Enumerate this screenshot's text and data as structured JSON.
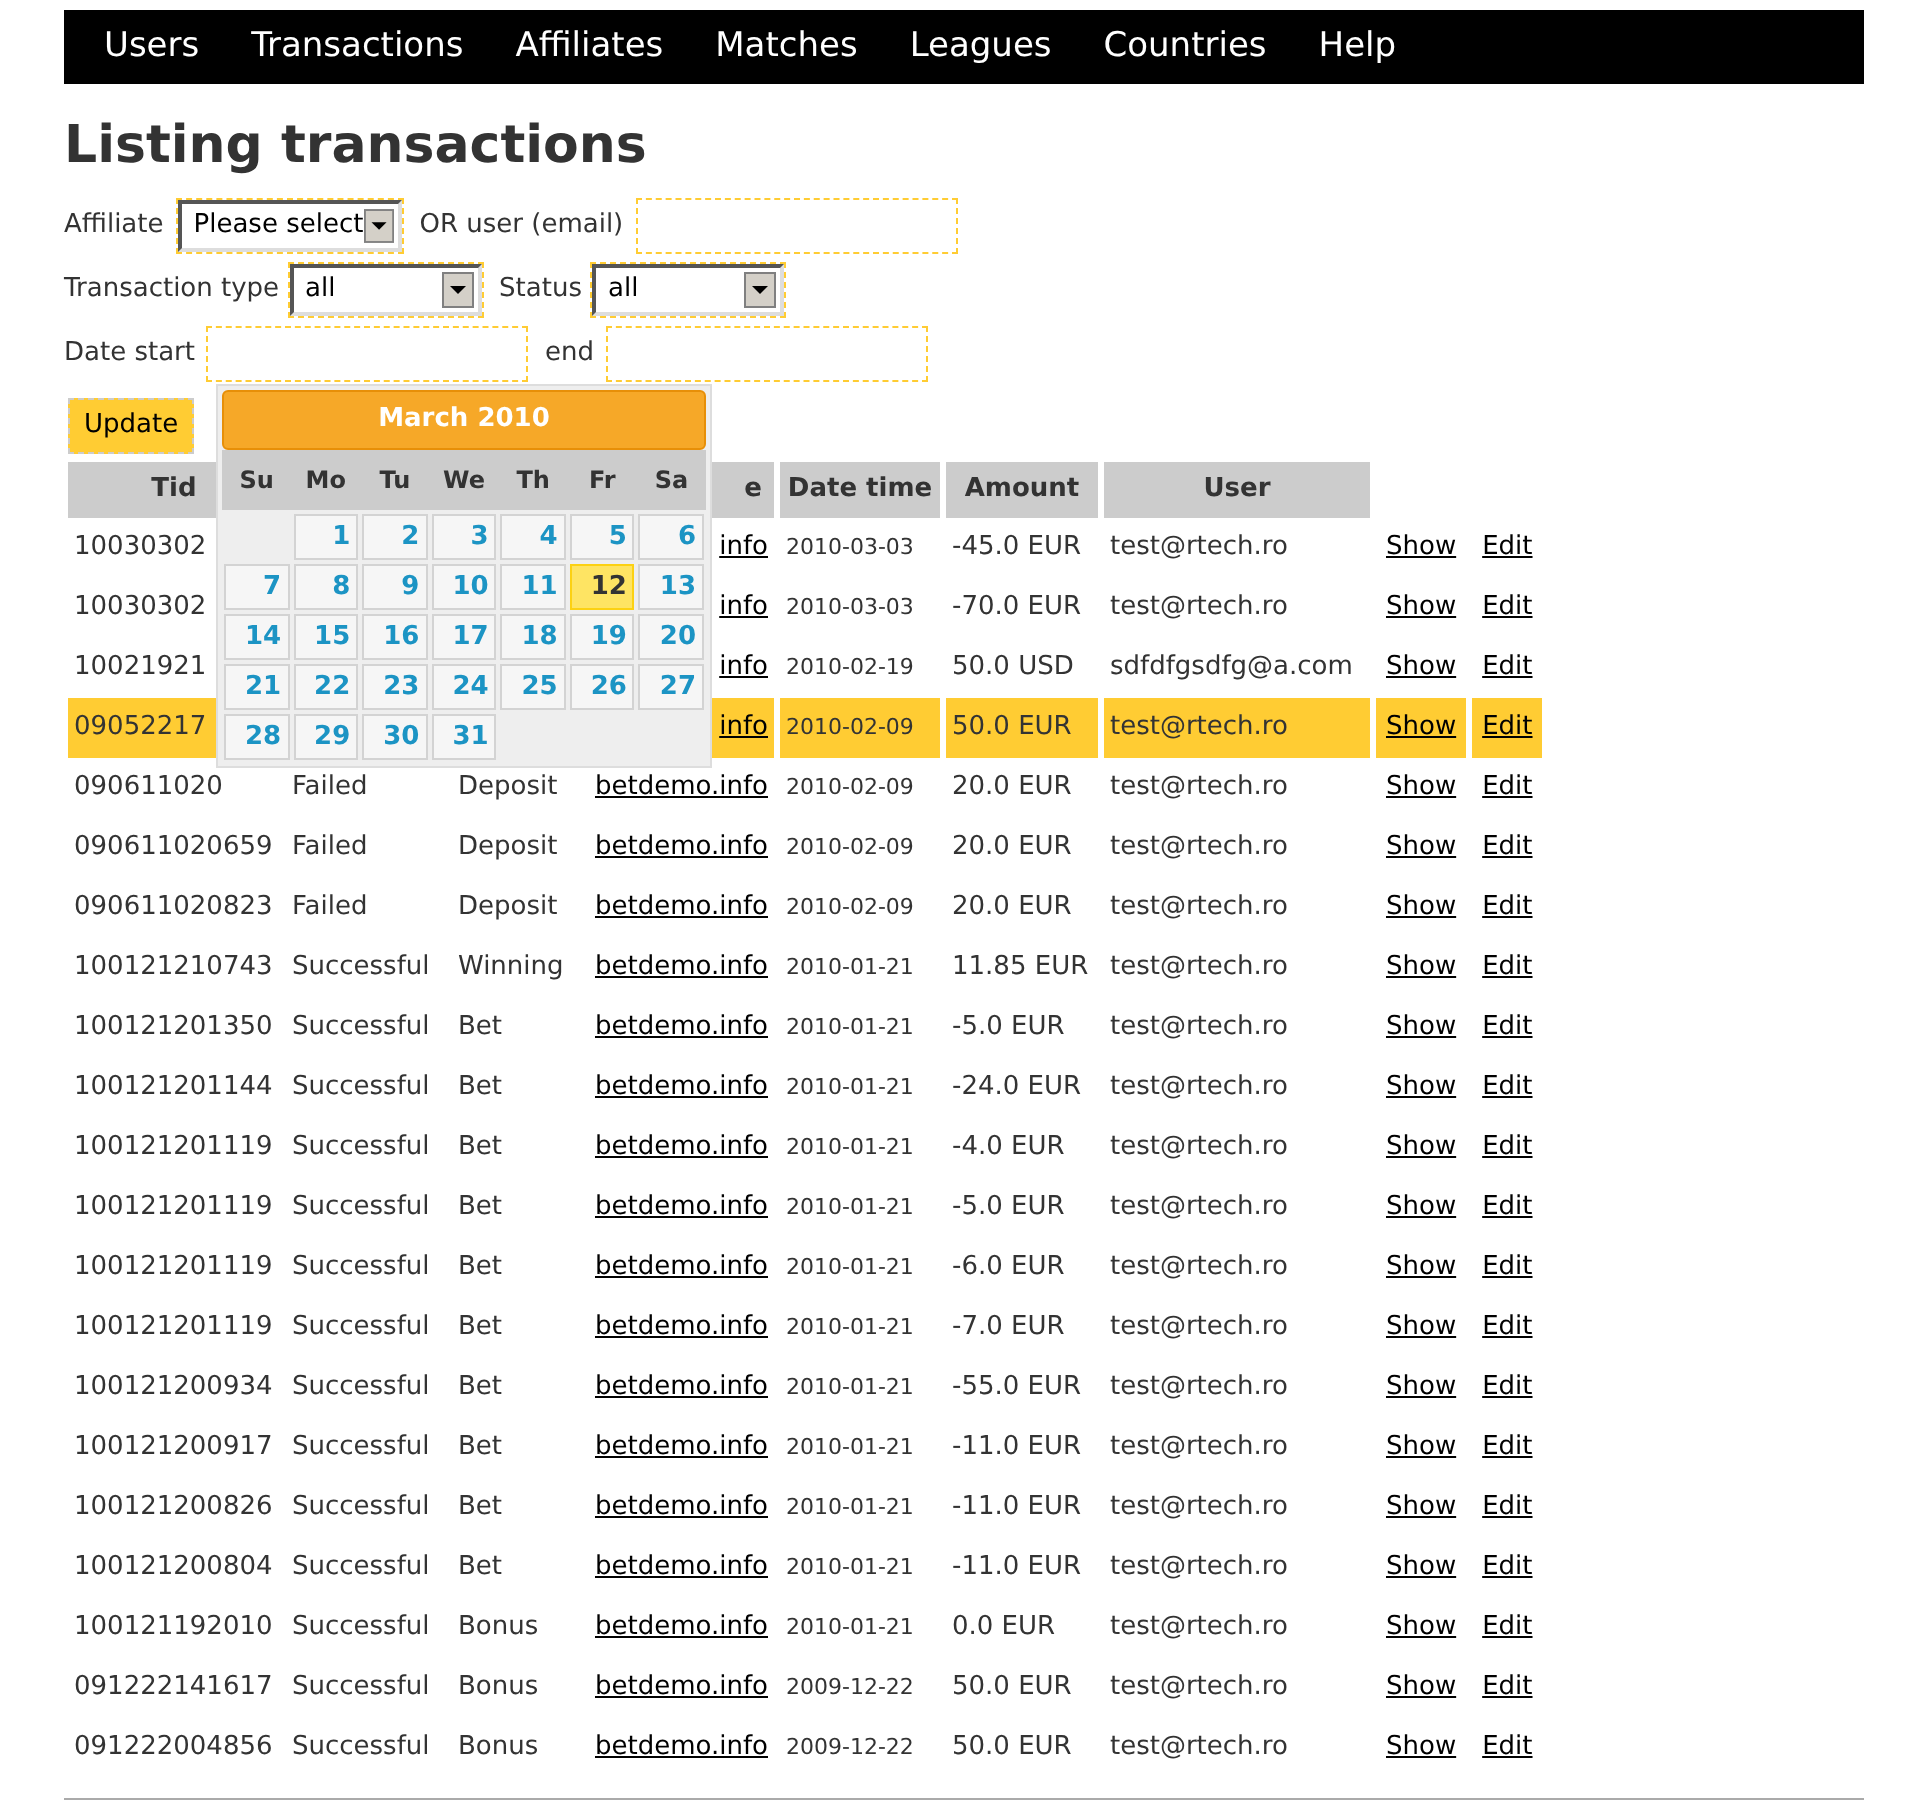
{
  "nav": {
    "items": [
      "Users",
      "Transactions",
      "Affiliates",
      "Matches",
      "Leagues",
      "Countries",
      "Help"
    ]
  },
  "title": "Listing transactions",
  "filters": {
    "affiliate_label": "Affiliate",
    "affiliate_value": "Please select",
    "user_label": "OR user (email)",
    "type_label": "Transaction type",
    "type_value": "all",
    "status_label": "Status",
    "status_value": "all",
    "date_start_label": "Date start",
    "date_end_label": "end",
    "update_button": "Update"
  },
  "calendar": {
    "title": "March 2010",
    "weekdays": [
      "Su",
      "Mo",
      "Tu",
      "We",
      "Th",
      "Fr",
      "Sa"
    ],
    "weeks": [
      [
        {
          "day": "1",
          "selected": false
        },
        {
          "day": "2",
          "selected": false
        },
        {
          "day": "3",
          "selected": false
        },
        {
          "day": "4",
          "selected": false
        },
        {
          "day": "5",
          "selected": false
        },
        {
          "day": "6",
          "selected": false
        }
      ],
      [
        {
          "day": "7",
          "selected": false
        },
        {
          "day": "8",
          "selected": false
        },
        {
          "day": "9",
          "selected": false
        },
        {
          "day": "10",
          "selected": false
        },
        {
          "day": "11",
          "selected": false
        },
        {
          "day": "12",
          "selected": true
        },
        {
          "day": "13",
          "selected": false
        }
      ],
      [
        {
          "day": "14",
          "selected": false
        },
        {
          "day": "15",
          "selected": false
        },
        {
          "day": "16",
          "selected": false
        },
        {
          "day": "17",
          "selected": false
        },
        {
          "day": "18",
          "selected": false
        },
        {
          "day": "19",
          "selected": false
        },
        {
          "day": "20",
          "selected": false
        }
      ],
      [
        {
          "day": "21",
          "selected": false
        },
        {
          "day": "22",
          "selected": false
        },
        {
          "day": "23",
          "selected": false
        },
        {
          "day": "24",
          "selected": false
        },
        {
          "day": "25",
          "selected": false
        },
        {
          "day": "26",
          "selected": false
        },
        {
          "day": "27",
          "selected": false
        }
      ],
      [
        {
          "day": "28",
          "selected": false
        },
        {
          "day": "29",
          "selected": false
        },
        {
          "day": "30",
          "selected": false
        },
        {
          "day": "31",
          "selected": false
        }
      ]
    ]
  },
  "table": {
    "columns": [
      "Tid",
      "e",
      "Date time",
      "Amount",
      "User"
    ],
    "rows": [
      {
        "tid": "10030302",
        "site": "info",
        "date": "2010-03-03",
        "amount": "-45.0 EUR",
        "user": "test@rtech.ro",
        "show": "Show",
        "edit": "Edit",
        "selected": false
      },
      {
        "tid": "10030302",
        "site": "info",
        "date": "2010-03-03",
        "amount": "-70.0 EUR",
        "user": "test@rtech.ro",
        "show": "Show",
        "edit": "Edit",
        "selected": false
      },
      {
        "tid": "10021921",
        "site": "info",
        "date": "2010-02-19",
        "amount": "50.0 USD",
        "user": "sdfdfgsdfg@a.com",
        "show": "Show",
        "edit": "Edit",
        "selected": false
      },
      {
        "tid": "09052217",
        "site": "info",
        "date": "2010-02-09",
        "amount": "50.0 EUR",
        "user": "test@rtech.ro",
        "show": "Show",
        "edit": "Edit",
        "selected": true
      },
      {
        "tid": "090611020",
        "status": "Failed",
        "type": "Deposit",
        "site": "betdemo.info",
        "date": "2010-02-09",
        "amount": "20.0 EUR",
        "user": "test@rtech.ro",
        "show": "Show",
        "edit": "Edit",
        "selected": false
      },
      {
        "tid": "090611020659",
        "status": "Failed",
        "type": "Deposit",
        "site": "betdemo.info",
        "date": "2010-02-09",
        "amount": "20.0 EUR",
        "user": "test@rtech.ro",
        "show": "Show",
        "edit": "Edit",
        "selected": false
      },
      {
        "tid": "090611020823",
        "status": "Failed",
        "type": "Deposit",
        "site": "betdemo.info",
        "date": "2010-02-09",
        "amount": "20.0 EUR",
        "user": "test@rtech.ro",
        "show": "Show",
        "edit": "Edit",
        "selected": false
      },
      {
        "tid": "100121210743",
        "status": "Successful",
        "type": "Winning",
        "site": "betdemo.info",
        "date": "2010-01-21",
        "amount": "11.85 EUR",
        "user": "test@rtech.ro",
        "show": "Show",
        "edit": "Edit",
        "selected": false
      },
      {
        "tid": "100121201350",
        "status": "Successful",
        "type": "Bet",
        "site": "betdemo.info",
        "date": "2010-01-21",
        "amount": "-5.0 EUR",
        "user": "test@rtech.ro",
        "show": "Show",
        "edit": "Edit",
        "selected": false
      },
      {
        "tid": "100121201144",
        "status": "Successful",
        "type": "Bet",
        "site": "betdemo.info",
        "date": "2010-01-21",
        "amount": "-24.0 EUR",
        "user": "test@rtech.ro",
        "show": "Show",
        "edit": "Edit",
        "selected": false
      },
      {
        "tid": "100121201119",
        "status": "Successful",
        "type": "Bet",
        "site": "betdemo.info",
        "date": "2010-01-21",
        "amount": "-4.0 EUR",
        "user": "test@rtech.ro",
        "show": "Show",
        "edit": "Edit",
        "selected": false
      },
      {
        "tid": "100121201119",
        "status": "Successful",
        "type": "Bet",
        "site": "betdemo.info",
        "date": "2010-01-21",
        "amount": "-5.0 EUR",
        "user": "test@rtech.ro",
        "show": "Show",
        "edit": "Edit",
        "selected": false
      },
      {
        "tid": "100121201119",
        "status": "Successful",
        "type": "Bet",
        "site": "betdemo.info",
        "date": "2010-01-21",
        "amount": "-6.0 EUR",
        "user": "test@rtech.ro",
        "show": "Show",
        "edit": "Edit",
        "selected": false
      },
      {
        "tid": "100121201119",
        "status": "Successful",
        "type": "Bet",
        "site": "betdemo.info",
        "date": "2010-01-21",
        "amount": "-7.0 EUR",
        "user": "test@rtech.ro",
        "show": "Show",
        "edit": "Edit",
        "selected": false
      },
      {
        "tid": "100121200934",
        "status": "Successful",
        "type": "Bet",
        "site": "betdemo.info",
        "date": "2010-01-21",
        "amount": "-55.0 EUR",
        "user": "test@rtech.ro",
        "show": "Show",
        "edit": "Edit",
        "selected": false
      },
      {
        "tid": "100121200917",
        "status": "Successful",
        "type": "Bet",
        "site": "betdemo.info",
        "date": "2010-01-21",
        "amount": "-11.0 EUR",
        "user": "test@rtech.ro",
        "show": "Show",
        "edit": "Edit",
        "selected": false
      },
      {
        "tid": "100121200826",
        "status": "Successful",
        "type": "Bet",
        "site": "betdemo.info",
        "date": "2010-01-21",
        "amount": "-11.0 EUR",
        "user": "test@rtech.ro",
        "show": "Show",
        "edit": "Edit",
        "selected": false
      },
      {
        "tid": "100121200804",
        "status": "Successful",
        "type": "Bet",
        "site": "betdemo.info",
        "date": "2010-01-21",
        "amount": "-11.0 EUR",
        "user": "test@rtech.ro",
        "show": "Show",
        "edit": "Edit",
        "selected": false
      },
      {
        "tid": "100121192010",
        "status": "Successful",
        "type": "Bonus",
        "site": "betdemo.info",
        "date": "2010-01-21",
        "amount": "0.0 EUR",
        "user": "test@rtech.ro",
        "show": "Show",
        "edit": "Edit",
        "selected": false
      },
      {
        "tid": "091222141617",
        "status": "Successful",
        "type": "Bonus",
        "site": "betdemo.info",
        "date": "2009-12-22",
        "amount": "50.0 EUR",
        "user": "test@rtech.ro",
        "show": "Show",
        "edit": "Edit",
        "selected": false
      },
      {
        "tid": "091222004856",
        "status": "Successful",
        "type": "Bonus",
        "site": "betdemo.info",
        "date": "2009-12-22",
        "amount": "50.0 EUR",
        "user": "test@rtech.ro",
        "show": "Show",
        "edit": "Edit",
        "selected": false
      }
    ]
  }
}
